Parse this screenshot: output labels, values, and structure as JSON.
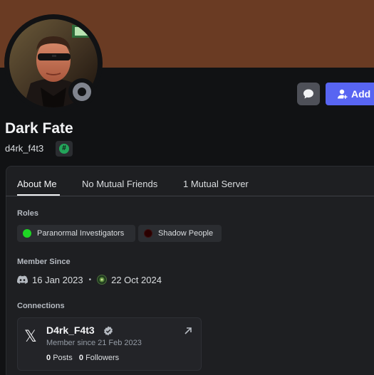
{
  "profile": {
    "banner_color": "#6a3b23",
    "display_name": "Dark Fate",
    "username": "d4rk_f4t3",
    "badge_icon": "hash-badge-icon",
    "status": "offline",
    "status_color": "#80848e"
  },
  "actions": {
    "message_icon": "chat-bubble-icon",
    "add_friend_label": "Add F",
    "accent_color": "#5865f2"
  },
  "tabs": [
    {
      "label": "About Me",
      "active": true
    },
    {
      "label": "No Mutual Friends",
      "active": false
    },
    {
      "label": "1 Mutual Server",
      "active": false
    }
  ],
  "roles": {
    "heading": "Roles",
    "items": [
      {
        "label": "Paranormal Investigators",
        "color": "#1ed724"
      },
      {
        "label": "Shadow People",
        "color": "#2a0000"
      }
    ]
  },
  "member_since": {
    "heading": "Member Since",
    "discord_date": "16 Jan 2023",
    "separator": "•",
    "server_date": "22 Oct 2024"
  },
  "connections": {
    "heading": "Connections",
    "items": [
      {
        "platform_icon": "x-logo-icon",
        "platform_glyph": "𝕏",
        "name": "D4rk_F4t3",
        "verified": true,
        "since": "Member since 21 Feb 2023",
        "posts_count": "0",
        "posts_label": "Posts",
        "followers_count": "0",
        "followers_label": "Followers"
      }
    ]
  }
}
